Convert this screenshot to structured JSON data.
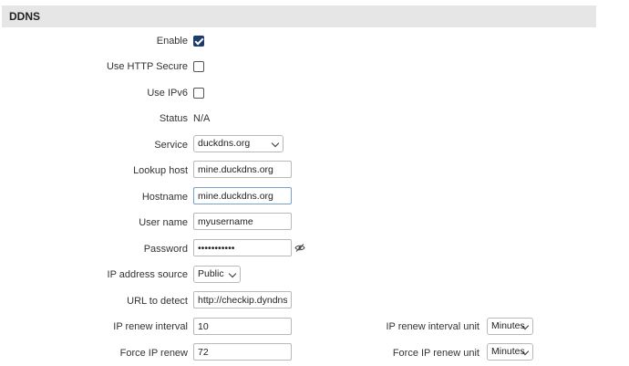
{
  "section": {
    "title": "DDNS"
  },
  "fields": {
    "enable": {
      "label": "Enable",
      "checked": true
    },
    "use_https": {
      "label": "Use HTTP Secure",
      "checked": false
    },
    "use_ipv6": {
      "label": "Use IPv6",
      "checked": false
    },
    "status": {
      "label": "Status",
      "value": "N/A"
    },
    "service": {
      "label": "Service",
      "value": "duckdns.org"
    },
    "lookup_host": {
      "label": "Lookup host",
      "value": "mine.duckdns.org"
    },
    "hostname": {
      "label": "Hostname",
      "value": "mine.duckdns.org"
    },
    "user_name": {
      "label": "User name",
      "value": "myusername"
    },
    "password": {
      "label": "Password",
      "value": "•••••••••••"
    },
    "ip_source": {
      "label": "IP address source",
      "value": "Public"
    },
    "url_detect": {
      "label": "URL to detect",
      "value": "http://checkip.dyndns.com"
    },
    "ip_renew_interval": {
      "label": "IP renew interval",
      "value": "10"
    },
    "ip_renew_interval_unit": {
      "label": "IP renew interval unit",
      "value": "Minutes"
    },
    "force_ip_renew": {
      "label": "Force IP renew",
      "value": "72"
    },
    "force_ip_renew_unit": {
      "label": "Force IP renew unit",
      "value": "Minutes"
    }
  },
  "icons": {
    "password_toggle": "eye-slash-icon",
    "select_arrow": "chevron-down-icon"
  },
  "colors": {
    "header_bg": "#e6e6e6",
    "checkbox_checked": "#1e3b6e"
  }
}
